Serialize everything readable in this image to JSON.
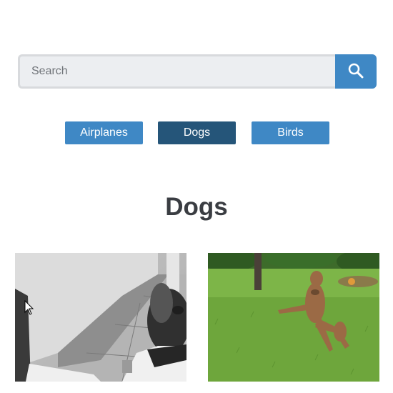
{
  "search": {
    "placeholder": "Search",
    "value": "",
    "button_icon": "search-icon"
  },
  "filters": [
    {
      "label": "Airplanes",
      "active": false
    },
    {
      "label": "Dogs",
      "active": true
    },
    {
      "label": "Birds",
      "active": false
    }
  ],
  "gallery": {
    "title": "Dogs",
    "photos": [
      {
        "description": "black-and-white-dog-sidewalk-photo"
      },
      {
        "description": "brown-dog-jumping-on-grass-photo"
      }
    ]
  },
  "colors": {
    "primary": "#3f88c5",
    "active": "#255579",
    "heading": "#3a3d42",
    "input_bg": "#eceef1"
  }
}
